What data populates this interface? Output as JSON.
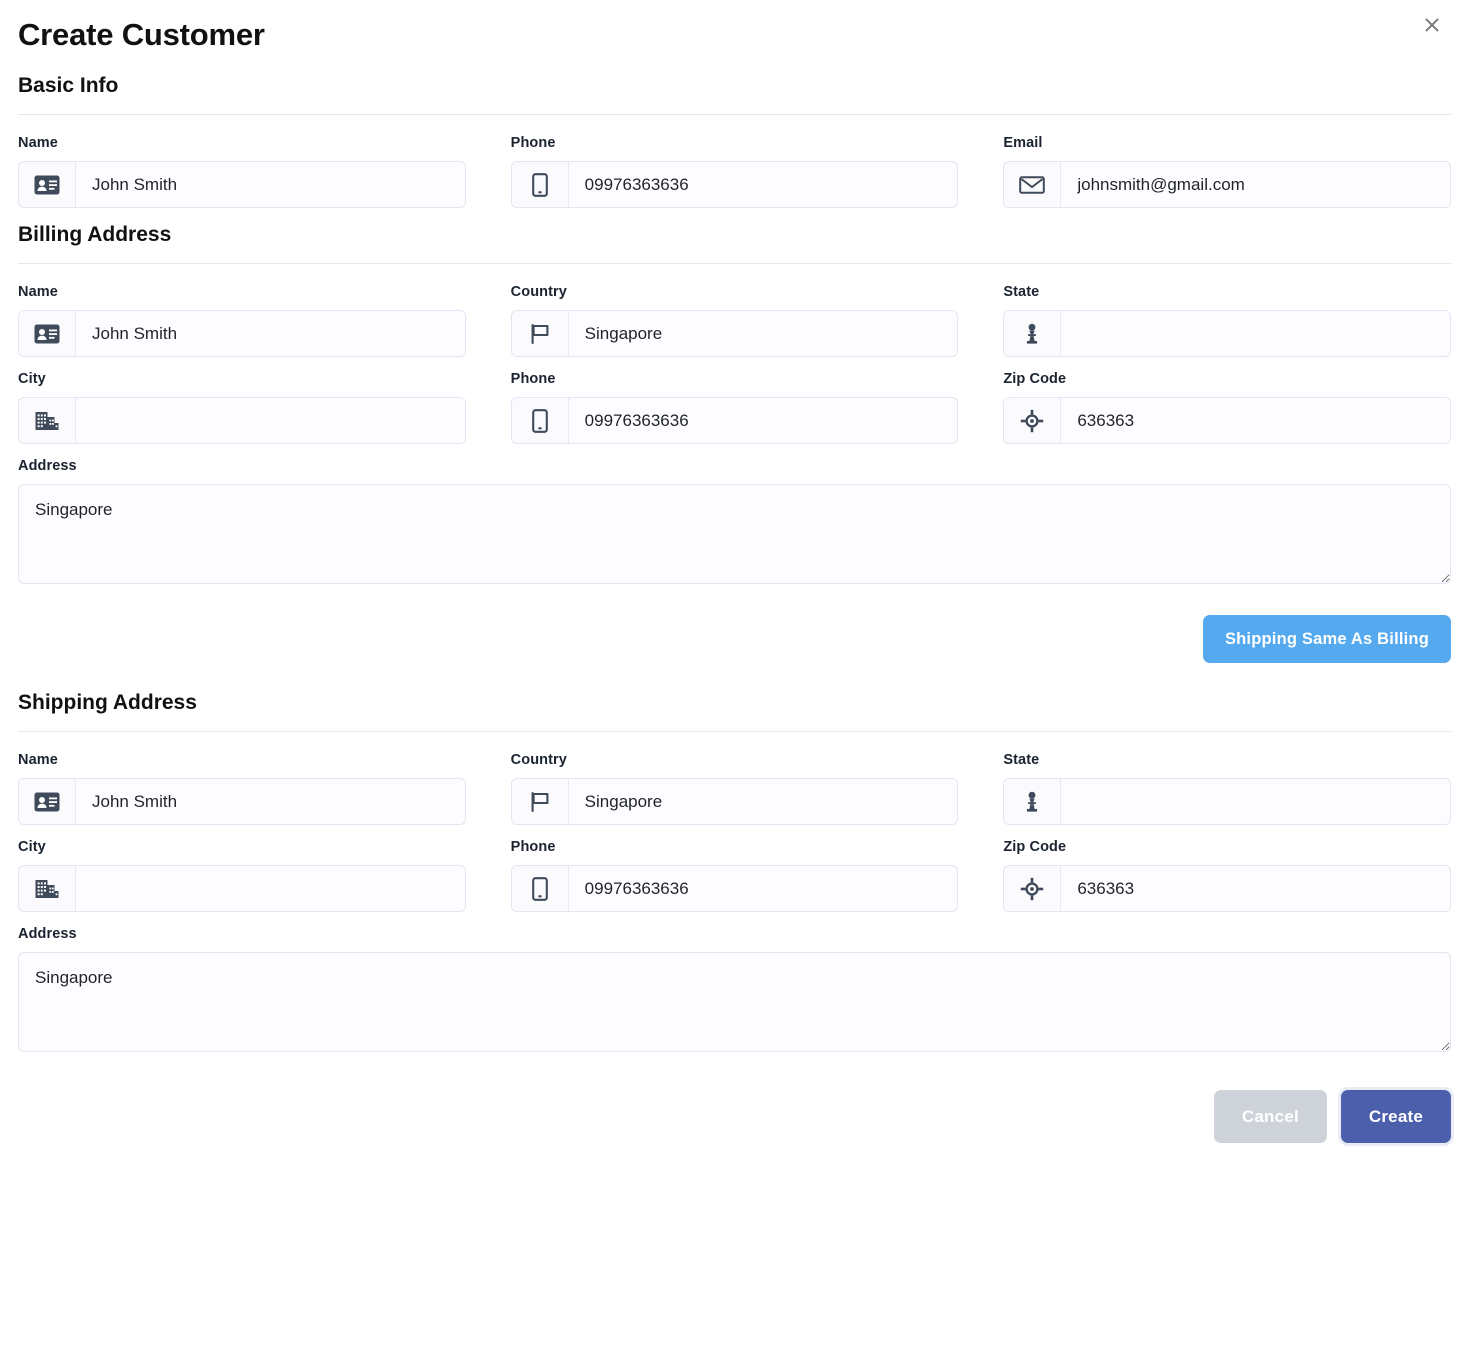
{
  "dialog": {
    "title": "Create Customer",
    "close_label": "✕"
  },
  "sections": {
    "basic_info": {
      "title": "Basic Info",
      "fields": {
        "name": {
          "label": "Name",
          "value": "John Smith",
          "icon": "vcard-icon"
        },
        "phone": {
          "label": "Phone",
          "value": "09976363636",
          "icon": "mobile-phone-icon"
        },
        "email": {
          "label": "Email",
          "value": "johnsmith@gmail.com",
          "icon": "envelope-icon"
        }
      }
    },
    "billing_address": {
      "title": "Billing Address",
      "fields": {
        "name": {
          "label": "Name",
          "value": "John Smith",
          "icon": "vcard-icon"
        },
        "country": {
          "label": "Country",
          "value": "Singapore",
          "icon": "flag-icon"
        },
        "state": {
          "label": "State",
          "value": "",
          "icon": "pawn-icon"
        },
        "city": {
          "label": "City",
          "value": "",
          "icon": "buildings-icon"
        },
        "phone": {
          "label": "Phone",
          "value": "09976363636",
          "icon": "mobile-phone-icon"
        },
        "zip": {
          "label": "Zip Code",
          "value": "636363",
          "icon": "crosshair-icon"
        },
        "address": {
          "label": "Address",
          "value": "Singapore"
        }
      }
    },
    "shipping_address": {
      "title": "Shipping Address",
      "fields": {
        "name": {
          "label": "Name",
          "value": "John Smith",
          "icon": "vcard-icon"
        },
        "country": {
          "label": "Country",
          "value": "Singapore",
          "icon": "flag-icon"
        },
        "state": {
          "label": "State",
          "value": "",
          "icon": "pawn-icon"
        },
        "city": {
          "label": "City",
          "value": "",
          "icon": "buildings-icon"
        },
        "phone": {
          "label": "Phone",
          "value": "09976363636",
          "icon": "mobile-phone-icon"
        },
        "zip": {
          "label": "Zip Code",
          "value": "636363",
          "icon": "crosshair-icon"
        },
        "address": {
          "label": "Address",
          "value": "Singapore"
        }
      }
    }
  },
  "actions": {
    "copy_billing": "Shipping Same As Billing",
    "cancel": "Cancel",
    "create": "Create"
  },
  "colors": {
    "copy_button": "#54a9ef",
    "cancel_button": "#ced3da",
    "create_button": "#4c5fad",
    "icon_dark": "#3f4a5a",
    "divider": "#e6e6f0",
    "field_border": "#e4e4f2"
  }
}
